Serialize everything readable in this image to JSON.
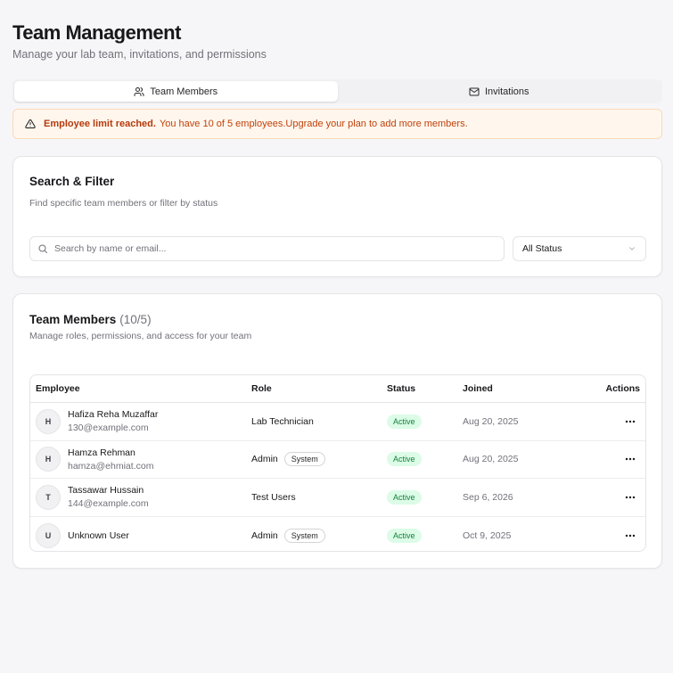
{
  "header": {
    "title": "Team Management",
    "subtitle": "Manage your lab team, invitations, and permissions"
  },
  "tabs": [
    {
      "label": "Team Members",
      "icon": "users-icon",
      "active": true
    },
    {
      "label": "Invitations",
      "icon": "mail-icon",
      "active": false
    }
  ],
  "alert": {
    "icon": "warning-triangle-icon",
    "title": "Employee limit reached.",
    "message": "You have 10 of 5 employees.",
    "link": "Upgrade your plan to add more members."
  },
  "search_filter": {
    "title": "Search & Filter",
    "description": "Find specific team members or filter by status",
    "search_placeholder": "Search by name or email...",
    "status_filter": "All Status"
  },
  "members": {
    "title": "Team Members",
    "count": "(10/5)",
    "description": "Manage roles, permissions, and access for your team",
    "columns": {
      "employee": "Employee",
      "role": "Role",
      "status": "Status",
      "joined": "Joined",
      "actions": "Actions"
    },
    "rows": [
      {
        "initial": "H",
        "name": "Hafiza Reha Muzaffar",
        "email": "130@example.com",
        "role": "Lab Technician",
        "badge": "",
        "status": "Active",
        "joined": "Aug 20, 2025"
      },
      {
        "initial": "H",
        "name": "Hamza Rehman",
        "email": "hamza@ehmiat.com",
        "role": "Admin",
        "badge": "System",
        "status": "Active",
        "joined": "Aug 20, 2025"
      },
      {
        "initial": "T",
        "name": "Tassawar Hussain",
        "email": "144@example.com",
        "role": "Test Users",
        "badge": "",
        "status": "Active",
        "joined": "Sep 6, 2026"
      },
      {
        "initial": "U",
        "name": "Unknown User",
        "email": "",
        "role": "Admin",
        "badge": "System",
        "status": "Active",
        "joined": "Oct 9, 2025"
      }
    ]
  },
  "colors": {
    "alert_bg": "#fff7ed",
    "alert_text": "#c2410c",
    "status_active_bg": "#dcfce7",
    "status_active_text": "#15803d"
  }
}
